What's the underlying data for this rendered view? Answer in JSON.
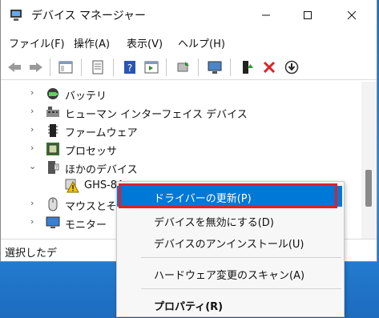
{
  "window": {
    "title": "デバイス マネージャー"
  },
  "menu": [
    "ファイル(F)",
    "操作(A)",
    "表示(V)",
    "ヘルプ(H)"
  ],
  "tree": [
    {
      "label": "バッテリ",
      "icon": "battery-icon",
      "expanded": false
    },
    {
      "label": "ヒューマン インターフェイス デバイス",
      "icon": "hid-icon",
      "expanded": false
    },
    {
      "label": "ファームウェア",
      "icon": "firmware-icon",
      "expanded": false
    },
    {
      "label": "プロセッサ",
      "icon": "processor-icon",
      "expanded": false
    },
    {
      "label": "ほかのデバイス",
      "icon": "other-devices-icon",
      "expanded": true
    },
    {
      "label": "GHS-8A",
      "icon": "warning-device-icon",
      "child": true
    },
    {
      "label": "マウスとその",
      "icon": "mouse-icon",
      "expanded": false
    },
    {
      "label": "モニター",
      "icon": "monitor-icon",
      "expanded": false
    }
  ],
  "status": {
    "text": "選択したデ"
  },
  "context_menu": {
    "items": [
      {
        "label": "ドライバーの更新(P)",
        "highlighted": true
      },
      {
        "label": "デバイスを無効にする(D)"
      },
      {
        "label": "デバイスのアンインストール(U)"
      },
      {
        "label": "ハードウェア変更のスキャン(A)"
      },
      {
        "label": "プロパティ(R)",
        "bold": true
      }
    ]
  },
  "colors": {
    "highlight": "#0078d7",
    "annotation": "#e0202a"
  }
}
